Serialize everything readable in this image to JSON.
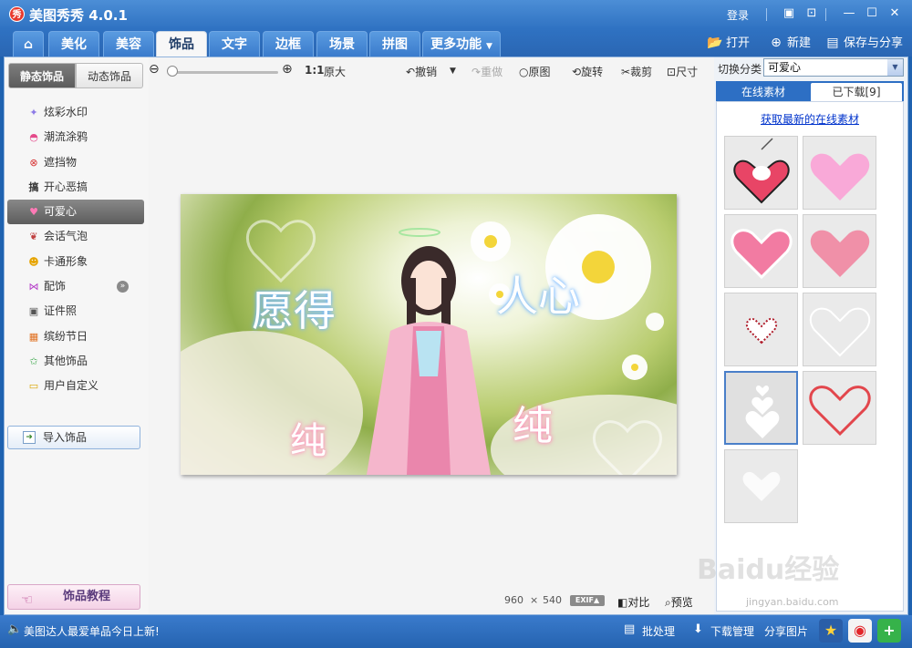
{
  "app": {
    "title": "美图秀秀 4.0.1",
    "logo": "秀"
  },
  "titlebar": {
    "login": "登录"
  },
  "tabs": [
    {
      "label": "美化"
    },
    {
      "label": "美容"
    },
    {
      "label": "饰品"
    },
    {
      "label": "文字"
    },
    {
      "label": "边框"
    },
    {
      "label": "场景"
    },
    {
      "label": "拼图"
    },
    {
      "label": "更多功能"
    }
  ],
  "toolbar": {
    "open": "打开",
    "new": "新建",
    "save_share": "保存与分享"
  },
  "left": {
    "subtab_static": "静态饰品",
    "subtab_dynamic": "动态饰品",
    "categories": [
      {
        "label": "炫彩水印",
        "icon": "sparkle-icon"
      },
      {
        "label": "潮流涂鸦",
        "icon": "lips-icon"
      },
      {
        "label": "遮挡物",
        "icon": "mask-icon"
      },
      {
        "label": "开心恶搞",
        "icon": "fun-icon"
      },
      {
        "label": "可爱心",
        "icon": "heart-icon"
      },
      {
        "label": "会话气泡",
        "icon": "bubble-icon"
      },
      {
        "label": "卡通形象",
        "icon": "cartoon-icon"
      },
      {
        "label": "配饰",
        "icon": "bow-icon"
      },
      {
        "label": "证件照",
        "icon": "id-photo-icon"
      },
      {
        "label": "缤纷节日",
        "icon": "gift-icon"
      },
      {
        "label": "其他饰品",
        "icon": "star-icon"
      },
      {
        "label": "用户自定义",
        "icon": "folder-icon"
      }
    ],
    "active_index": 4,
    "import_label": "导入饰品",
    "tutorial_label": "饰品教程"
  },
  "edit": {
    "one_to_one": "1:1",
    "original_size": "原大",
    "undo": "撤销",
    "redo": "重做",
    "original": "原图",
    "rotate": "旋转",
    "crop": "裁剪",
    "size": "尺寸"
  },
  "canvas": {
    "text1": "愿得",
    "text2": "人心",
    "text3": "纯",
    "text4": "纯"
  },
  "status": {
    "width": "960",
    "times": "×",
    "height": "540",
    "exif": "EXIF▲",
    "compare": "对比",
    "preview": "预览"
  },
  "right": {
    "switch_label": "切换分类",
    "switch_value": "可爱心",
    "tab_online": "在线素材",
    "tab_downloaded": "已下载[9]",
    "get_link": "获取最新的在线素材",
    "selected_thumb": 6
  },
  "bottom": {
    "news": "美图达人最爱单品今日上新!",
    "batch": "批处理",
    "download_mgr": "下载管理",
    "share": "分享图片"
  },
  "watermark": {
    "brand": "Baidu经验",
    "url": "jingyan.baidu.com"
  },
  "colors": {
    "accent": "#2f72c2",
    "active_tab_text": "#1d3b66",
    "link": "#0033cc"
  }
}
